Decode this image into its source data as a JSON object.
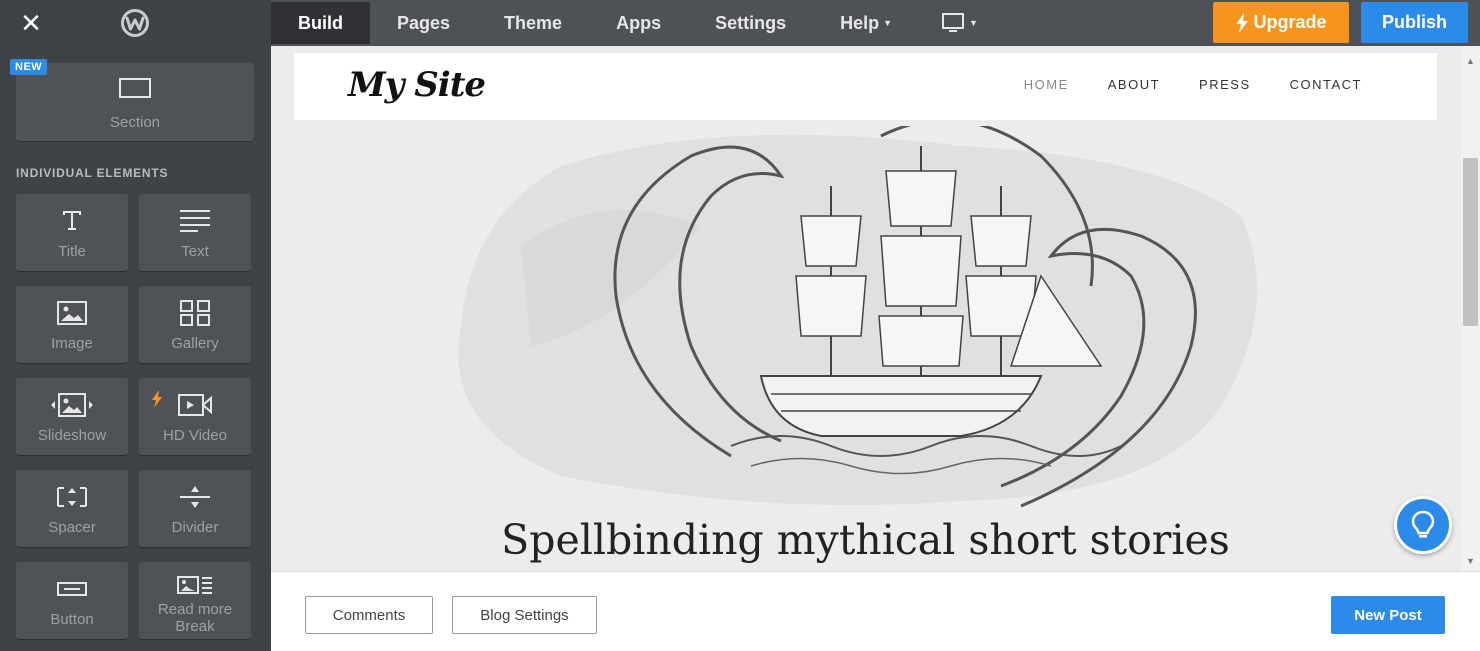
{
  "topbar": {
    "nav": [
      {
        "label": "Build",
        "active": true
      },
      {
        "label": "Pages"
      },
      {
        "label": "Theme"
      },
      {
        "label": "Apps"
      },
      {
        "label": "Settings"
      },
      {
        "label": "Help",
        "dropdown": true
      }
    ],
    "upgrade_label": "Upgrade",
    "publish_label": "Publish"
  },
  "sidebar": {
    "new_badge": "NEW",
    "section_tile": "Section",
    "heading": "INDIVIDUAL ELEMENTS",
    "elements": [
      {
        "label": "Title",
        "icon": "title-icon"
      },
      {
        "label": "Text",
        "icon": "text-icon"
      },
      {
        "label": "Image",
        "icon": "image-icon"
      },
      {
        "label": "Gallery",
        "icon": "gallery-icon"
      },
      {
        "label": "Slideshow",
        "icon": "slideshow-icon"
      },
      {
        "label": "HD Video",
        "icon": "video-icon",
        "premium": true
      },
      {
        "label": "Spacer",
        "icon": "spacer-icon"
      },
      {
        "label": "Divider",
        "icon": "divider-icon"
      },
      {
        "label": "Button",
        "icon": "button-icon"
      },
      {
        "label_line1": "Read more",
        "label_line2": "Break",
        "icon": "read-more-icon"
      }
    ]
  },
  "site": {
    "logo": "My Site",
    "nav": [
      "HOME",
      "ABOUT",
      "PRESS",
      "CONTACT"
    ],
    "hero_title": "Spellbinding mythical short stories"
  },
  "bottombar": {
    "comments_label": "Comments",
    "blog_settings_label": "Blog Settings",
    "new_post_label": "New Post"
  },
  "colors": {
    "accent": "#2c8be8",
    "upgrade": "#f7941d",
    "sidebar": "#3f4246",
    "topbar": "#4e5155"
  }
}
